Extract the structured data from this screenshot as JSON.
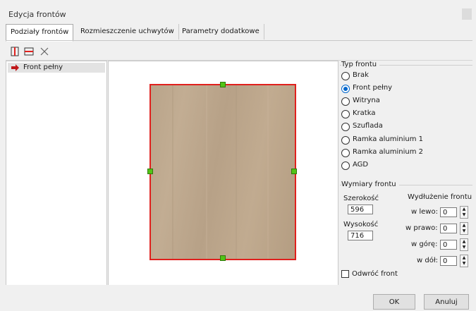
{
  "window": {
    "title": "Edycja frontów"
  },
  "tabs": [
    {
      "label": "Podziały frontów",
      "active": true
    },
    {
      "label": "Rozmieszczenie uchwytów",
      "active": false
    },
    {
      "label": "Parametry dodatkowe",
      "active": false
    }
  ],
  "toolbar": {
    "icons": [
      "split-vertical-icon",
      "split-horizontal-icon",
      "delete-icon"
    ]
  },
  "list": {
    "items": [
      {
        "label": "Front pełny",
        "icon": "arrow-right-icon"
      }
    ]
  },
  "typ_frontu": {
    "title": "Typ frontu",
    "options": [
      "Brak",
      "Front pełny",
      "Witryna",
      "Kratka",
      "Szuflada",
      "Ramka aluminium 1",
      "Ramka aluminium 2",
      "AGD"
    ],
    "selected": "Front pełny"
  },
  "wymiary": {
    "title": "Wymiary frontu",
    "width_label": "Szerokość",
    "width_value": "596",
    "height_label": "Wysokość",
    "height_value": "716",
    "extension_title": "Wydłużenie frontu",
    "left_label": "w lewo:",
    "left_value": "0",
    "right_label": "w prawo:",
    "right_value": "0",
    "up_label": "w górę:",
    "up_value": "0",
    "down_label": "w dół:",
    "down_value": "0"
  },
  "flip": {
    "label": "Odwróć front",
    "checked": false
  },
  "buttons": {
    "ok": "OK",
    "cancel": "Anuluj"
  },
  "colors": {
    "selection_border": "#e0201d",
    "handle": "#52c416",
    "accent": "#0066cc"
  }
}
